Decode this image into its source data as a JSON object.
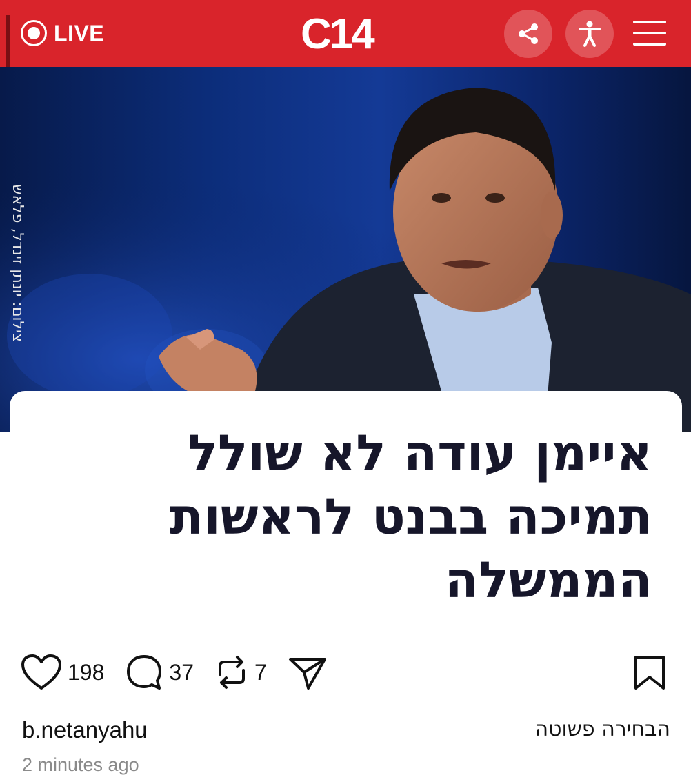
{
  "header": {
    "live_label": "LIVE",
    "logo_text": "C14",
    "brand_color": "#d9242b",
    "share_icon": "share-icon",
    "accessibility_icon": "accessibility-icon",
    "menu_icon": "hamburger-menu-icon"
  },
  "hero": {
    "photo_credit": "צילום: יונתן זינדל, פלאש"
  },
  "article": {
    "headline_lines": [
      "איימן עודה לא שולל",
      "תמיכה בבנט לראשות",
      "הממשלה"
    ]
  },
  "post": {
    "likes": "198",
    "comments": "37",
    "reposts": "7",
    "username": "b.netanyahu",
    "caption": "הבחירה פשוטה",
    "timestamp": "2 minutes ago",
    "icons": [
      "heart-icon",
      "comment-icon",
      "repost-icon",
      "send-icon",
      "bookmark-icon"
    ]
  }
}
